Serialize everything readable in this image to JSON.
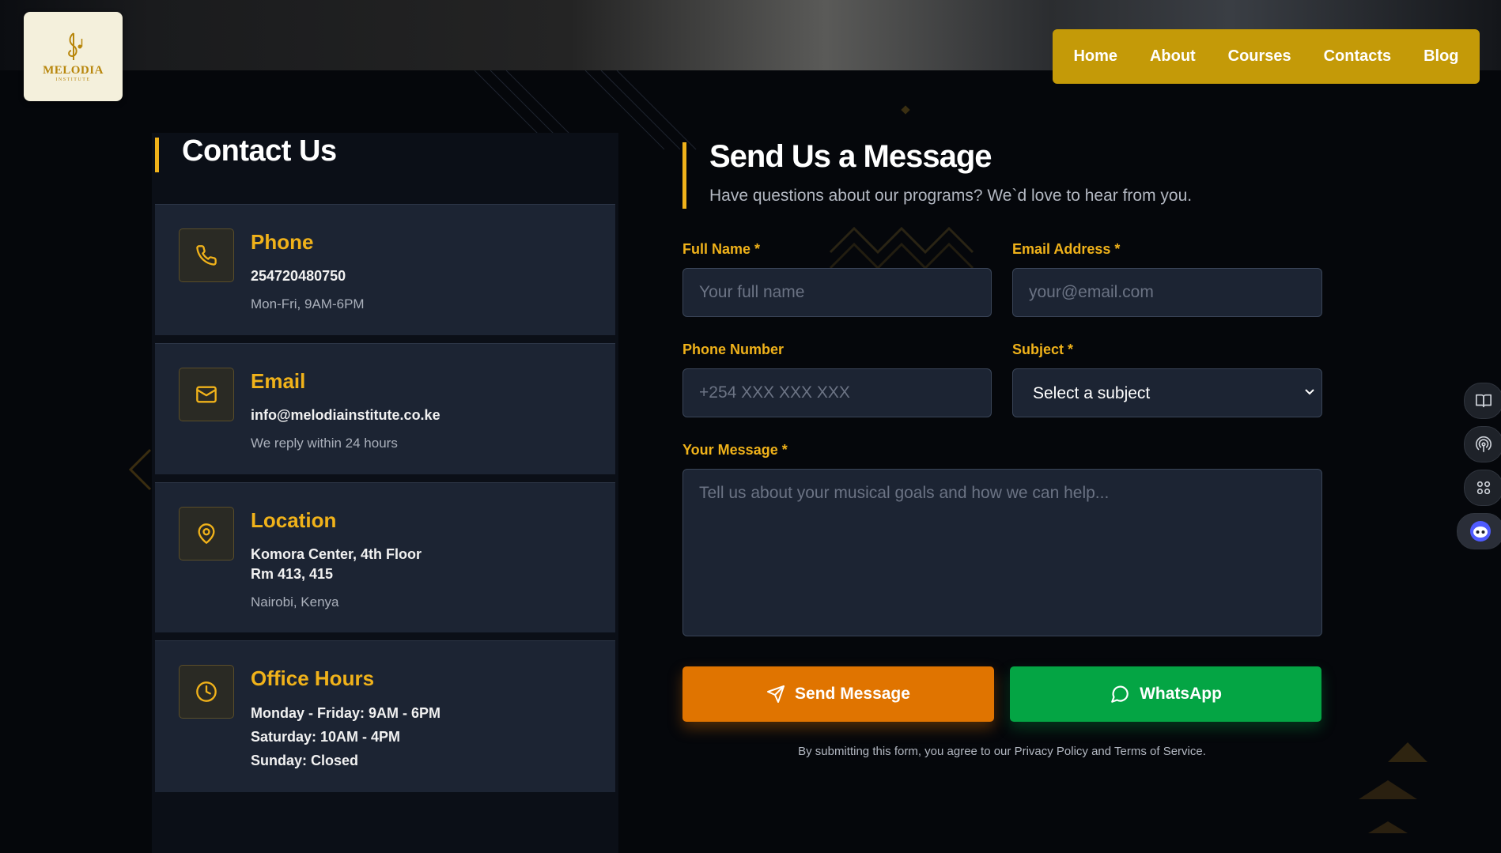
{
  "brand": {
    "name": "MELODIA",
    "subtitle": "INSTITUTE"
  },
  "nav": {
    "items": [
      "Home",
      "About",
      "Courses",
      "Contacts",
      "Blog"
    ]
  },
  "contact": {
    "title": "Contact Us",
    "cards": [
      {
        "title": "Phone",
        "icon": "phone-icon",
        "primary": "254720480750",
        "secondary": "Mon-Fri, 9AM-6PM"
      },
      {
        "title": "Email",
        "icon": "mail-icon",
        "primary": "info@melodiainstitute.co.ke",
        "secondary": "We reply within 24 hours"
      },
      {
        "title": "Location",
        "icon": "map-pin-icon",
        "primary": "Komora Center, 4th Floor",
        "primary2": "Rm 413, 415",
        "secondary": "Nairobi, Kenya"
      },
      {
        "title": "Office Hours",
        "icon": "clock-icon",
        "line1": "Monday - Friday: 9AM - 6PM",
        "line2": "Saturday: 10AM - 4PM",
        "line3": "Sunday: Closed"
      }
    ]
  },
  "form": {
    "title": "Send Us a Message",
    "subtitle": "Have questions about our programs? We`d love to hear from you.",
    "full_name": {
      "label": "Full Name *",
      "placeholder": "Your full name",
      "value": ""
    },
    "email": {
      "label": "Email Address *",
      "placeholder": "your@email.com",
      "value": ""
    },
    "phone": {
      "label": "Phone Number",
      "placeholder": "+254 XXX XXX XXX",
      "value": ""
    },
    "subject": {
      "label": "Subject *",
      "selected": "Select a subject"
    },
    "message": {
      "label": "Your Message *",
      "placeholder": "Tell us about your musical goals and how we can help...",
      "value": ""
    },
    "send_label": "Send Message",
    "whatsapp_label": "WhatsApp",
    "disclaimer": "By submitting this form, you agree to our Privacy Policy and Terms of Service."
  },
  "side_tools": [
    "book-open-icon",
    "broadcast-icon",
    "apps-grid-icon",
    "assistant-bot-icon"
  ],
  "colors": {
    "accent": "#f0b21a",
    "nav_bg": "#c49a08",
    "card_bg": "#1c2433",
    "send_button": "#e07400",
    "whatsapp_button": "#04a544",
    "page_bg": "#05070b"
  }
}
